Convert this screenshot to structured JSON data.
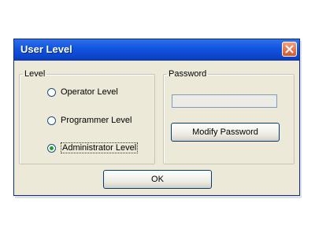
{
  "window": {
    "title": "User Level",
    "close_icon": "close-icon"
  },
  "level_group": {
    "legend": "Level",
    "options": [
      {
        "label": "Operator Level",
        "checked": false
      },
      {
        "label": "Programmer Level",
        "checked": false
      },
      {
        "label": "Administrator Level",
        "checked": true
      }
    ]
  },
  "password_group": {
    "legend": "Password",
    "password_value": "",
    "modify_button_label": "Modify Password"
  },
  "footer": {
    "ok_button_label": "OK"
  },
  "colors": {
    "titlebar": "#1155e0",
    "window_bg": "#ece9d8",
    "close_button": "#d6552e",
    "radio_dot": "#21a121"
  }
}
